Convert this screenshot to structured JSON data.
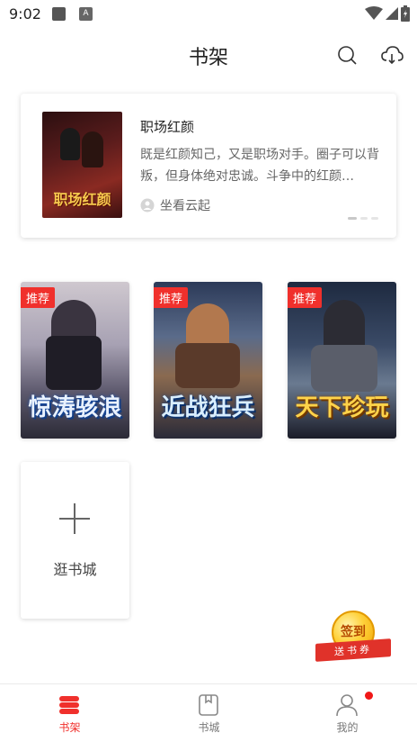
{
  "status_bar": {
    "time": "9:02",
    "badge_letter": "A",
    "icons": [
      "square-icon",
      "a-badge-icon",
      "wifi-icon",
      "signal-icon",
      "battery-icon"
    ]
  },
  "header": {
    "title": "书架",
    "icons": [
      "search-icon",
      "cloud-download-icon"
    ]
  },
  "recommended": {
    "title": "职场红颜",
    "description": "既是红颜知己，又是职场对手。圈子可以背叛，但身体绝对忠诚。斗争中的红颜…",
    "author": "坐看云起",
    "cover_text": "职场红颜",
    "carousel_total": 3,
    "carousel_active_index": 0
  },
  "books": [
    {
      "tag": "推荐",
      "cover_text": "惊涛骇浪"
    },
    {
      "tag": "推荐",
      "cover_text": "近战狂兵"
    },
    {
      "tag": "推荐",
      "cover_text": "天下珍玩"
    }
  ],
  "add_book": {
    "label": "逛书城"
  },
  "sign_in": {
    "coin_label": "签到",
    "ribbon_label": "送书券"
  },
  "bottom_nav": {
    "items": [
      {
        "label": "书架",
        "icon": "bookshelf-icon",
        "active": true
      },
      {
        "label": "书城",
        "icon": "bookstore-icon",
        "active": false
      },
      {
        "label": "我的",
        "icon": "profile-icon",
        "active": false,
        "has_badge": true
      }
    ]
  },
  "colors": {
    "accent": "#f0302c",
    "text_primary": "#222222",
    "text_secondary": "#666666"
  }
}
